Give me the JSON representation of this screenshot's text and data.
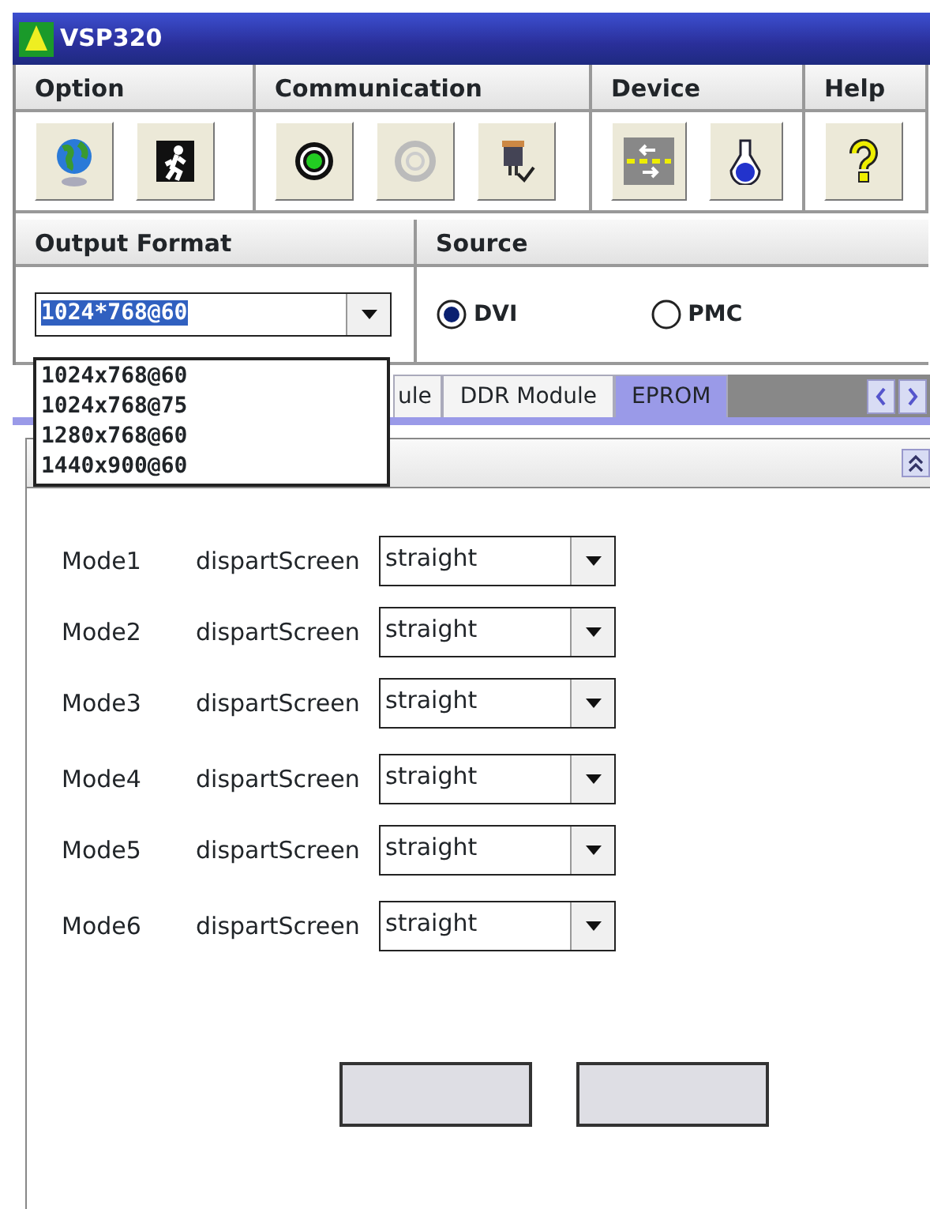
{
  "window": {
    "title": "VSP320"
  },
  "menu_groups": [
    {
      "label": "Option",
      "tools": [
        {
          "kind": "globe"
        },
        {
          "kind": "exit"
        }
      ]
    },
    {
      "label": "Communication",
      "tools": [
        {
          "kind": "connect"
        },
        {
          "kind": "disconnect"
        },
        {
          "kind": "plug"
        }
      ]
    },
    {
      "label": "Device",
      "tools": [
        {
          "kind": "swap"
        },
        {
          "kind": "flask"
        }
      ]
    },
    {
      "label": "Help",
      "tools": [
        {
          "kind": "help"
        }
      ]
    }
  ],
  "output_format": {
    "label": "Output Format",
    "value": "1024*768@60",
    "expanded": true,
    "options": [
      "1024x768@60",
      "1024x768@75",
      "1280x768@60",
      "1440x900@60"
    ]
  },
  "source": {
    "label": "Source",
    "options": [
      {
        "label": "DVI",
        "selected": true
      },
      {
        "label": "PMC",
        "selected": false
      }
    ]
  },
  "tabs": [
    {
      "label": "ule",
      "selected": false
    },
    {
      "label": "DDR Module",
      "selected": false
    },
    {
      "label": "EPROM",
      "selected": true
    }
  ],
  "modes": [
    {
      "label": "Mode1",
      "field": "dispartScreen",
      "value": "straight"
    },
    {
      "label": "Mode2",
      "field": "dispartScreen",
      "value": "straight"
    },
    {
      "label": "Mode3",
      "field": "dispartScreen",
      "value": "straight"
    },
    {
      "label": "Mode4",
      "field": "dispartScreen",
      "value": "straight"
    },
    {
      "label": "Mode5",
      "field": "dispartScreen",
      "value": "straight"
    },
    {
      "label": "Mode6",
      "field": "dispartScreen",
      "value": "straight"
    }
  ],
  "buttons": [
    {
      "disabled": true
    },
    {
      "disabled": true
    }
  ]
}
